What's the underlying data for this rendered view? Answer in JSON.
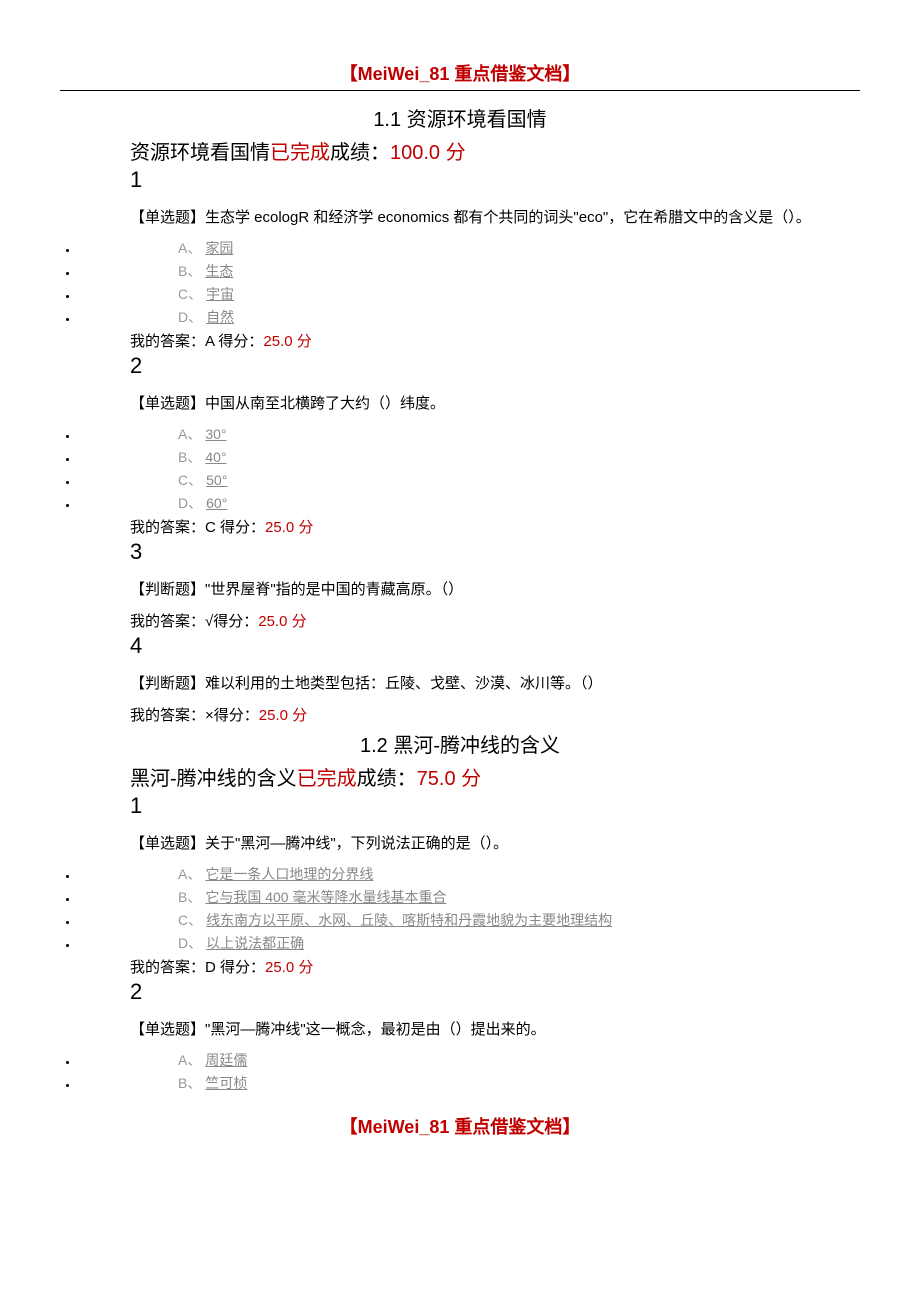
{
  "header_text": "【MeiWei_81 重点借鉴文档】",
  "footer_text": "【MeiWei_81 重点借鉴文档】",
  "sections": [
    {
      "title": "1.1 资源环境看国情",
      "subtitle_pre": "资源环境看国情",
      "status": "已完成",
      "score_label": "成绩：",
      "score_value": "100.0 分",
      "questions": [
        {
          "num": "1",
          "text": "【单选题】生态学 ecologR 和经济学 economics 都有个共同的词头\"eco\"，它在希腊文中的含义是（）。",
          "options": [
            {
              "letter": "A、",
              "text": "家园"
            },
            {
              "letter": "B、",
              "text": "生态"
            },
            {
              "letter": "C、",
              "text": "宇宙"
            },
            {
              "letter": "D、",
              "text": "自然"
            }
          ],
          "answer_pre": "我的答案：A 得分：",
          "answer_score": "25.0 分"
        },
        {
          "num": "2",
          "text": "【单选题】中国从南至北横跨了大约（）纬度。",
          "options": [
            {
              "letter": "A、",
              "text": "30°"
            },
            {
              "letter": "B、",
              "text": "40°"
            },
            {
              "letter": "C、",
              "text": "50°"
            },
            {
              "letter": "D、",
              "text": "60°"
            }
          ],
          "answer_pre": "我的答案：C 得分：",
          "answer_score": "25.0 分"
        },
        {
          "num": "3",
          "text": "【判断题】\"世界屋脊\"指的是中国的青藏高原。（）",
          "options": [],
          "answer_pre": "我的答案：√得分：",
          "answer_score": "25.0 分"
        },
        {
          "num": "4",
          "text": "【判断题】难以利用的土地类型包括：丘陵、戈壁、沙漠、冰川等。（）",
          "options": [],
          "answer_pre": "我的答案：×得分：",
          "answer_score": "25.0 分"
        }
      ]
    },
    {
      "title": "1.2 黑河-腾冲线的含义",
      "subtitle_pre": "黑河-腾冲线的含义",
      "status": "已完成",
      "score_label": "成绩：",
      "score_value": "75.0 分",
      "questions": [
        {
          "num": "1",
          "text": "【单选题】关于\"黑河—腾冲线\"，下列说法正确的是（）。",
          "options": [
            {
              "letter": "A、",
              "text": "它是一条人口地理的分界线"
            },
            {
              "letter": "B、",
              "text": "它与我国 400 毫米等降水量线基本重合"
            },
            {
              "letter": "C、",
              "text": "线东南方以平原、水网、丘陵、喀斯特和丹霞地貌为主要地理结构"
            },
            {
              "letter": "D、",
              "text": "以上说法都正确"
            }
          ],
          "answer_pre": "我的答案：D 得分：",
          "answer_score": "25.0 分"
        },
        {
          "num": "2",
          "text": "【单选题】\"黑河—腾冲线\"这一概念，最初是由（）提出来的。",
          "options": [
            {
              "letter": "A、",
              "text": "周廷儒"
            },
            {
              "letter": "B、",
              "text": "竺可桢"
            }
          ],
          "answer_pre": "",
          "answer_score": ""
        }
      ]
    }
  ]
}
